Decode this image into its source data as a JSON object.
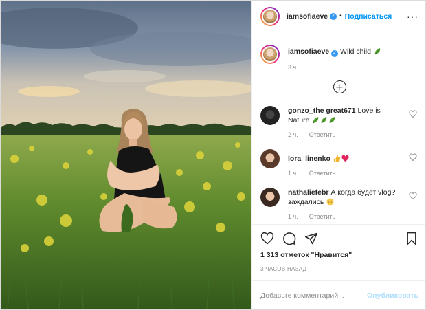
{
  "header": {
    "username": "iamsofiaeve",
    "separator": "•",
    "follow_label": "Подписаться",
    "more_label": "···"
  },
  "caption": {
    "username": "iamsofiaeve",
    "text": "Wild child",
    "time": "3 ч."
  },
  "comments": [
    {
      "username": "gonzo_the great671",
      "text": "Love is Nature",
      "time": "2 ч.",
      "reply": "Ответить"
    },
    {
      "username": "lora_linenko",
      "text": "",
      "time": "1 ч.",
      "reply": "Ответить"
    },
    {
      "username": "nathaliefebr",
      "text": "А когда будет vlog? заждались",
      "time": "1 ч.",
      "reply": "Ответить"
    }
  ],
  "likes": "1 313 отметок \"Нравится\"",
  "timestamp": "3 ЧАСОВ НАЗАД",
  "add_comment": {
    "placeholder": "Добавьте комментарий...",
    "publish_label": "Опубликовать"
  },
  "icons": {
    "verified": "verified-badge-icon",
    "leaf": "leaf-emoji-icon",
    "thumbs": "thumbs-up-emoji-icon",
    "heart_emoji": "red-heart-emoji-icon",
    "smile": "smile-emoji-icon",
    "like": "heart-outline-icon",
    "comment": "comment-bubble-icon",
    "share": "paper-plane-icon",
    "save": "bookmark-icon",
    "load_more": "plus-circle-icon"
  },
  "colors": {
    "accent": "#0095f6",
    "verified": "#3897f0",
    "muted": "#8e8e8e",
    "publish_disabled": "#b2dffc"
  }
}
